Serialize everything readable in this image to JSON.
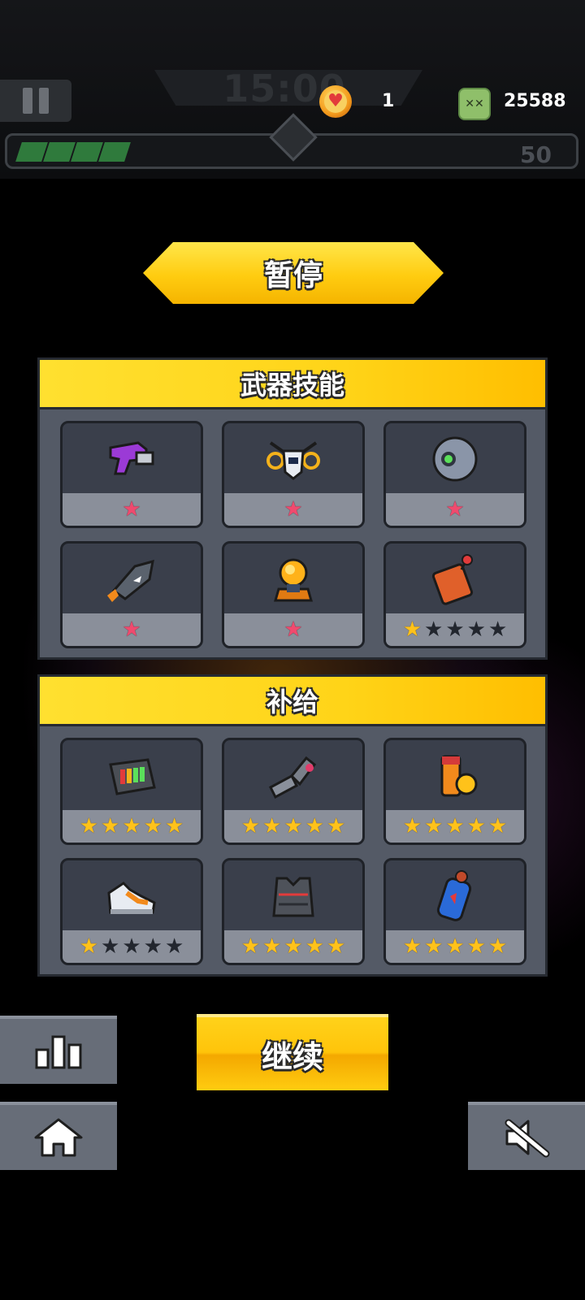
{
  "hud": {
    "timer": "15:00",
    "heart_count": "1",
    "kill_count": "25588",
    "level": "50",
    "xp_progress": 0.2
  },
  "title": "暂停",
  "weapons": {
    "heading": "武器技能",
    "items": [
      {
        "icon": "purple-blaster-icon",
        "stars": "★",
        "star_color": "#f04a6e"
      },
      {
        "icon": "drone-bot-icon",
        "stars": "★",
        "star_color": "#f04a6e"
      },
      {
        "icon": "sphere-orb-icon",
        "stars": "★",
        "star_color": "#f04a6e"
      },
      {
        "icon": "shark-rocket-icon",
        "stars": "★",
        "star_color": "#f04a6e"
      },
      {
        "icon": "plasma-turret-icon",
        "stars": "★",
        "star_color": "#f04a6e"
      },
      {
        "icon": "remote-detonator-icon",
        "filled": 1,
        "total": 5
      }
    ]
  },
  "supplies": {
    "heading": "补给",
    "items": [
      {
        "icon": "battery-pack-icon",
        "filled": 5,
        "total": 5
      },
      {
        "icon": "robot-arm-icon",
        "filled": 5,
        "total": 5
      },
      {
        "icon": "energy-drink-icon",
        "filled": 5,
        "total": 5
      },
      {
        "icon": "sneaker-icon",
        "filled": 1,
        "total": 5
      },
      {
        "icon": "armor-vest-icon",
        "filled": 5,
        "total": 5
      },
      {
        "icon": "fuel-canister-icon",
        "filled": 5,
        "total": 5
      }
    ]
  },
  "continue_label": "继续",
  "colors": {
    "accent": "#ffc21a",
    "panel": "#545a66",
    "weapon_star": "#f04a6e"
  }
}
